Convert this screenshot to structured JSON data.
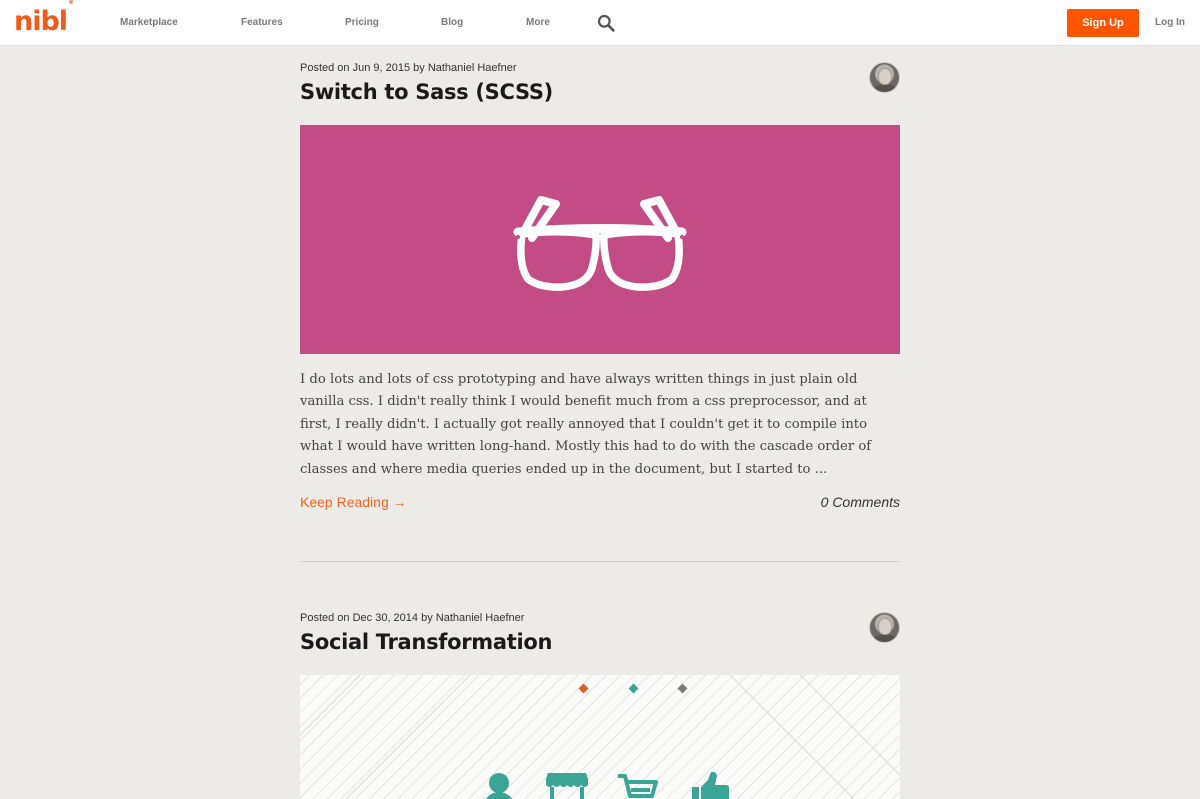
{
  "header": {
    "logo": "nibl",
    "logo_mark": "®",
    "nav": [
      "Marketplace",
      "Features",
      "Pricing",
      "Blog",
      "More"
    ],
    "search_icon": "search-icon",
    "signup_label": "Sign Up",
    "login_label": "Log In"
  },
  "colors": {
    "accent": "#ff5500",
    "link": "#f26522",
    "pink_hero": "#c44c86",
    "teal": "#3aa596",
    "background": "#ecebe7"
  },
  "posts": [
    {
      "meta": "Posted on Jun 9, 2015 by Nathaniel Haefner",
      "title": "Switch to Sass (SCSS)",
      "hero_icon": "glasses-icon",
      "excerpt": "I do lots and lots of css prototyping and have always written things in just plain old vanilla css. I didn't really think I would benefit much from a css preprocessor, and at first, I really didn't. I actually got really annoyed that I couldn't get it to compile into what I would have written long-hand. Mostly this had to do with the cascade order of classes and where media queries ended up in the document, but I started to ...",
      "keep_reading": "Keep Reading →",
      "comments": "0 Comments"
    },
    {
      "meta": "Posted on Dec 30, 2014 by Nathaniel Haefner",
      "title": "Social Transformation",
      "hero_icons": [
        "person-icon",
        "storefront-icon",
        "shopping-cart-icon",
        "thumbs-up-icon"
      ]
    }
  ]
}
